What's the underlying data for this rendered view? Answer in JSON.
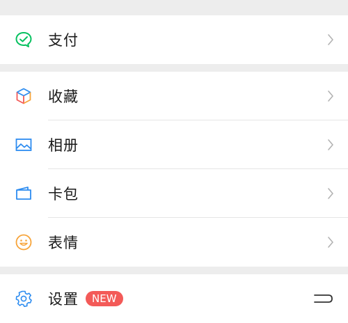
{
  "menu": {
    "pay": {
      "label": "支付",
      "icon": "wechat-pay-icon"
    },
    "favorites": {
      "label": "收藏",
      "icon": "cube-icon"
    },
    "album": {
      "label": "相册",
      "icon": "image-icon"
    },
    "cards": {
      "label": "卡包",
      "icon": "wallet-card-icon"
    },
    "stickers": {
      "label": "表情",
      "icon": "smiley-icon"
    },
    "settings": {
      "label": "设置",
      "badge": "NEW",
      "icon": "gear-icon"
    }
  },
  "colors": {
    "background": "#ededed",
    "row_bg": "#ffffff",
    "text": "#191919",
    "pay_green": "#07c160",
    "album_blue": "#2d8cf0",
    "smiley_orange": "#f7a43a",
    "badge_red": "#f35a58"
  }
}
